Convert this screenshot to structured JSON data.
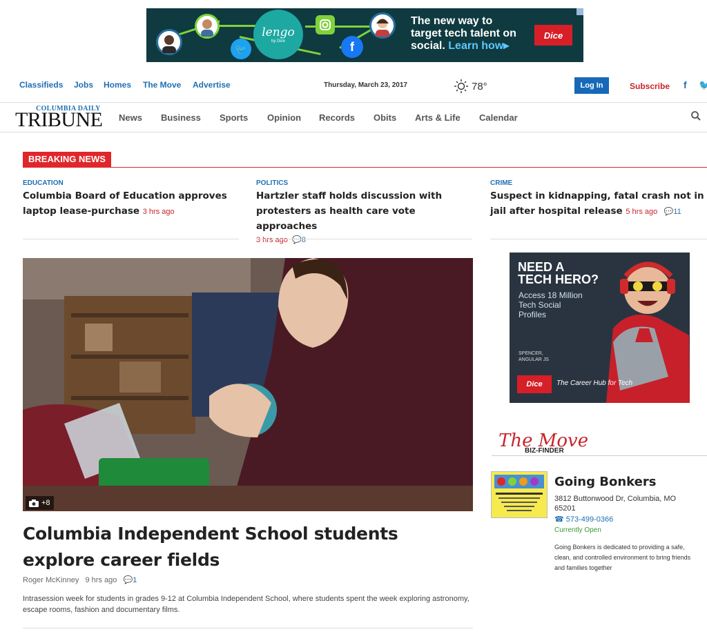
{
  "top_ad": {
    "logo_text": "lengo",
    "logo_sub": "by Dice",
    "line1": "The new way to",
    "line2": "target tech talent on",
    "line3": "social.",
    "learn": "Learn how",
    "learn_arrow": "▸",
    "brand": "Dice"
  },
  "utility": {
    "links": [
      "Classifieds",
      "Jobs",
      "Homes",
      "The Move",
      "Advertise"
    ],
    "date": "Thursday, March 23, 2017",
    "temperature": "78°",
    "login_label": "Log In",
    "subscribe_label": "Subscribe",
    "facebook_glyph": "f",
    "twitter_glyph": "🐦"
  },
  "masthead": {
    "small": "COLUMBIA DAILY",
    "big": "TRIBUNE"
  },
  "nav": {
    "items": [
      "News",
      "Business",
      "Sports",
      "Opinion",
      "Records",
      "Obits",
      "Arts & Life",
      "Calendar"
    ]
  },
  "breaking": {
    "label": "BREAKING NEWS",
    "stories": [
      {
        "category": "EDUCATION",
        "headline": "Columbia Board of Education approves laptop lease-purchase",
        "time": "3 hrs ago",
        "comments": ""
      },
      {
        "category": "POLITICS",
        "headline": "Hartzler staff holds discussion with protesters as health care vote approaches",
        "time": "3 hrs ago",
        "comments": "8"
      },
      {
        "category": "CRIME",
        "headline": "Suspect in kidnapping, fatal crash not in jail after hospital release",
        "time": "5 hrs ago",
        "comments": "11"
      }
    ]
  },
  "hero": {
    "photo_count": "+8",
    "title": "Columbia Independent School students explore career fields",
    "author": "Roger McKinney",
    "time": "9 hrs ago",
    "comments": "1",
    "summary": "Intrasession week for students in grades 9-12 at Columbia Independent School, where students spent the week exploring astronomy, escape rooms, fashion and documentary films."
  },
  "side_ad": {
    "headline_1": "NEED A",
    "headline_2": "TECH HERO?",
    "line_1": "Access 18 Million",
    "line_2": "Tech Social",
    "line_3": "Profiles",
    "small_1": "SPENCER,",
    "small_2": "ANGULAR JS",
    "brand": "Dice",
    "tagline": "The Career Hub for Tech"
  },
  "biz_finder": {
    "logo_text": "The Move",
    "logo_sub": "BIZ-FINDER",
    "name": "Going Bonkers",
    "address": "3812 Buttonwood Dr, Columbia, MO 65201",
    "phone": "573-499-0366",
    "status": "Currently Open",
    "description": "Going Bonkers is dedicated to providing a safe, clean, and controlled environment to bring friends and families together"
  },
  "colors": {
    "accent_blue": "#1f6fb3",
    "breaking_red": "#e0262b",
    "dice_red": "#d61f26"
  }
}
